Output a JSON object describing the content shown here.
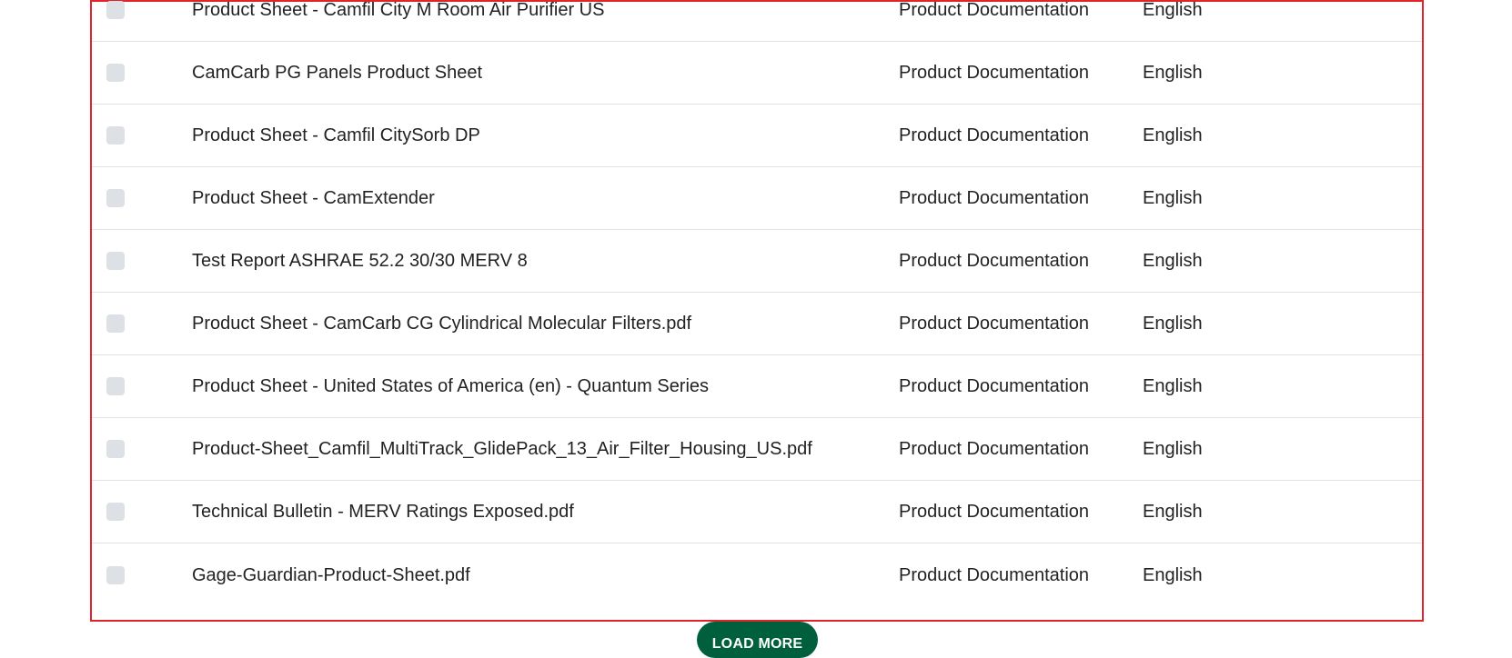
{
  "documents": [
    {
      "title": "Product Sheet - Camfil City M Room Air Purifier US",
      "type": "Product Documentation",
      "language": "English"
    },
    {
      "title": "CamCarb PG Panels Product Sheet",
      "type": "Product Documentation",
      "language": "English"
    },
    {
      "title": "Product Sheet - Camfil CitySorb DP",
      "type": "Product Documentation",
      "language": "English"
    },
    {
      "title": "Product Sheet - CamExtender",
      "type": "Product Documentation",
      "language": "English"
    },
    {
      "title": "Test Report ASHRAE 52.2 30/30 MERV 8",
      "type": "Product Documentation",
      "language": "English"
    },
    {
      "title": "Product Sheet - CamCarb CG Cylindrical Molecular Filters.pdf",
      "type": "Product Documentation",
      "language": "English"
    },
    {
      "title": "Product Sheet - United States of America (en) - Quantum Series",
      "type": "Product Documentation",
      "language": "English"
    },
    {
      "title": "Product-Sheet_Camfil_MultiTrack_GlidePack_13_Air_Filter_Housing_US.pdf",
      "type": "Product Documentation",
      "language": "English"
    },
    {
      "title": "Technical Bulletin - MERV Ratings Exposed.pdf",
      "type": "Product Documentation",
      "language": "English"
    },
    {
      "title": "Gage-Guardian-Product-Sheet.pdf",
      "type": "Product Documentation",
      "language": "English"
    }
  ],
  "load_more_label": "LOAD MORE",
  "colors": {
    "border": "#e1242b",
    "button": "#005f3c",
    "checkbox": "#dde0e4"
  }
}
